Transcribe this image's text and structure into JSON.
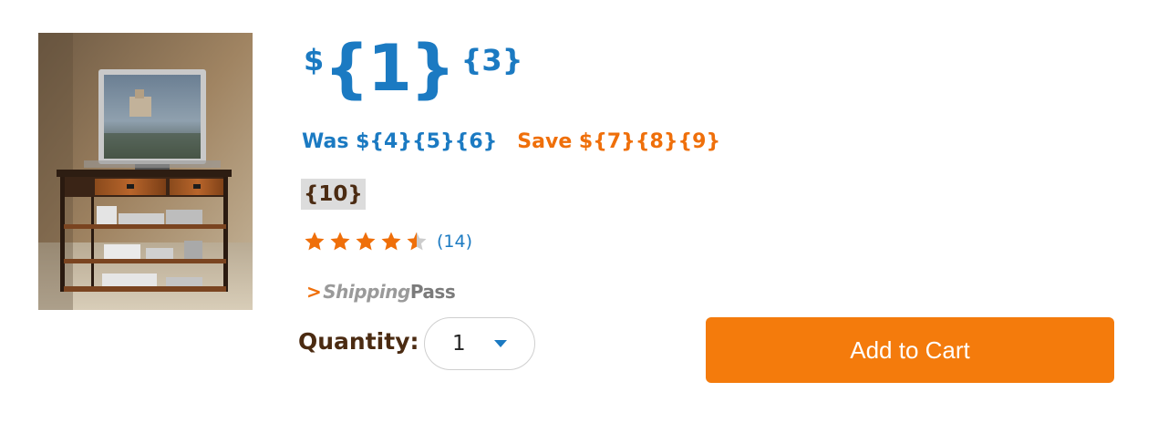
{
  "product": {
    "price_currency": "$",
    "price_whole": "{1}",
    "price_cents": "{3}",
    "was_text": "Was ${4}{5}{6}",
    "save_text": "Save ${7}{8}{9}",
    "badge_text": "{10}",
    "rating_stars": 4.5,
    "review_count": "(14)",
    "shipping_pass_prefix": "Shipping",
    "shipping_pass_suffix": "Pass",
    "shipping_pass_chevron": ">"
  },
  "quantity": {
    "label": "Quantity:",
    "value": "1"
  },
  "cart": {
    "button_label": "Add to Cart"
  },
  "colors": {
    "price_blue": "#1b7ac2",
    "save_orange": "#ef6f0a",
    "cart_orange": "#f47b0c",
    "star_orange": "#ef6f0a",
    "star_empty": "#cccccc"
  }
}
